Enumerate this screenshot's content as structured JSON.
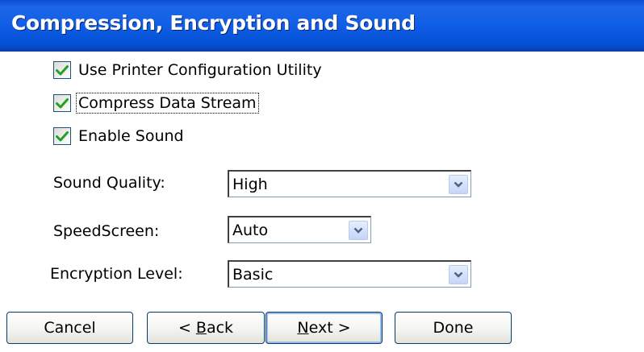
{
  "window": {
    "title": "Compression, Encryption and Sound"
  },
  "options": [
    {
      "label": "Use Printer Configuration Utility",
      "checked": true
    },
    {
      "label": "Compress Data Stream",
      "checked": true
    },
    {
      "label": "Enable Sound",
      "checked": true
    }
  ],
  "fields": {
    "sound_quality": {
      "label": "Sound Quality:",
      "value": "High"
    },
    "speedscreen": {
      "label": "SpeedScreen:",
      "value": "Auto"
    },
    "encryption_level": {
      "label": "Encryption Level:",
      "value": "Basic"
    }
  },
  "buttons": {
    "cancel": "Cancel",
    "back_prefix": "< ",
    "back_mnemonic": "B",
    "back_rest": "ack",
    "next_mnemonic": "N",
    "next_rest": "ext >",
    "done": "Done"
  },
  "colors": {
    "title_bar": "#0a4ed6",
    "checkmark": "#21a121"
  }
}
